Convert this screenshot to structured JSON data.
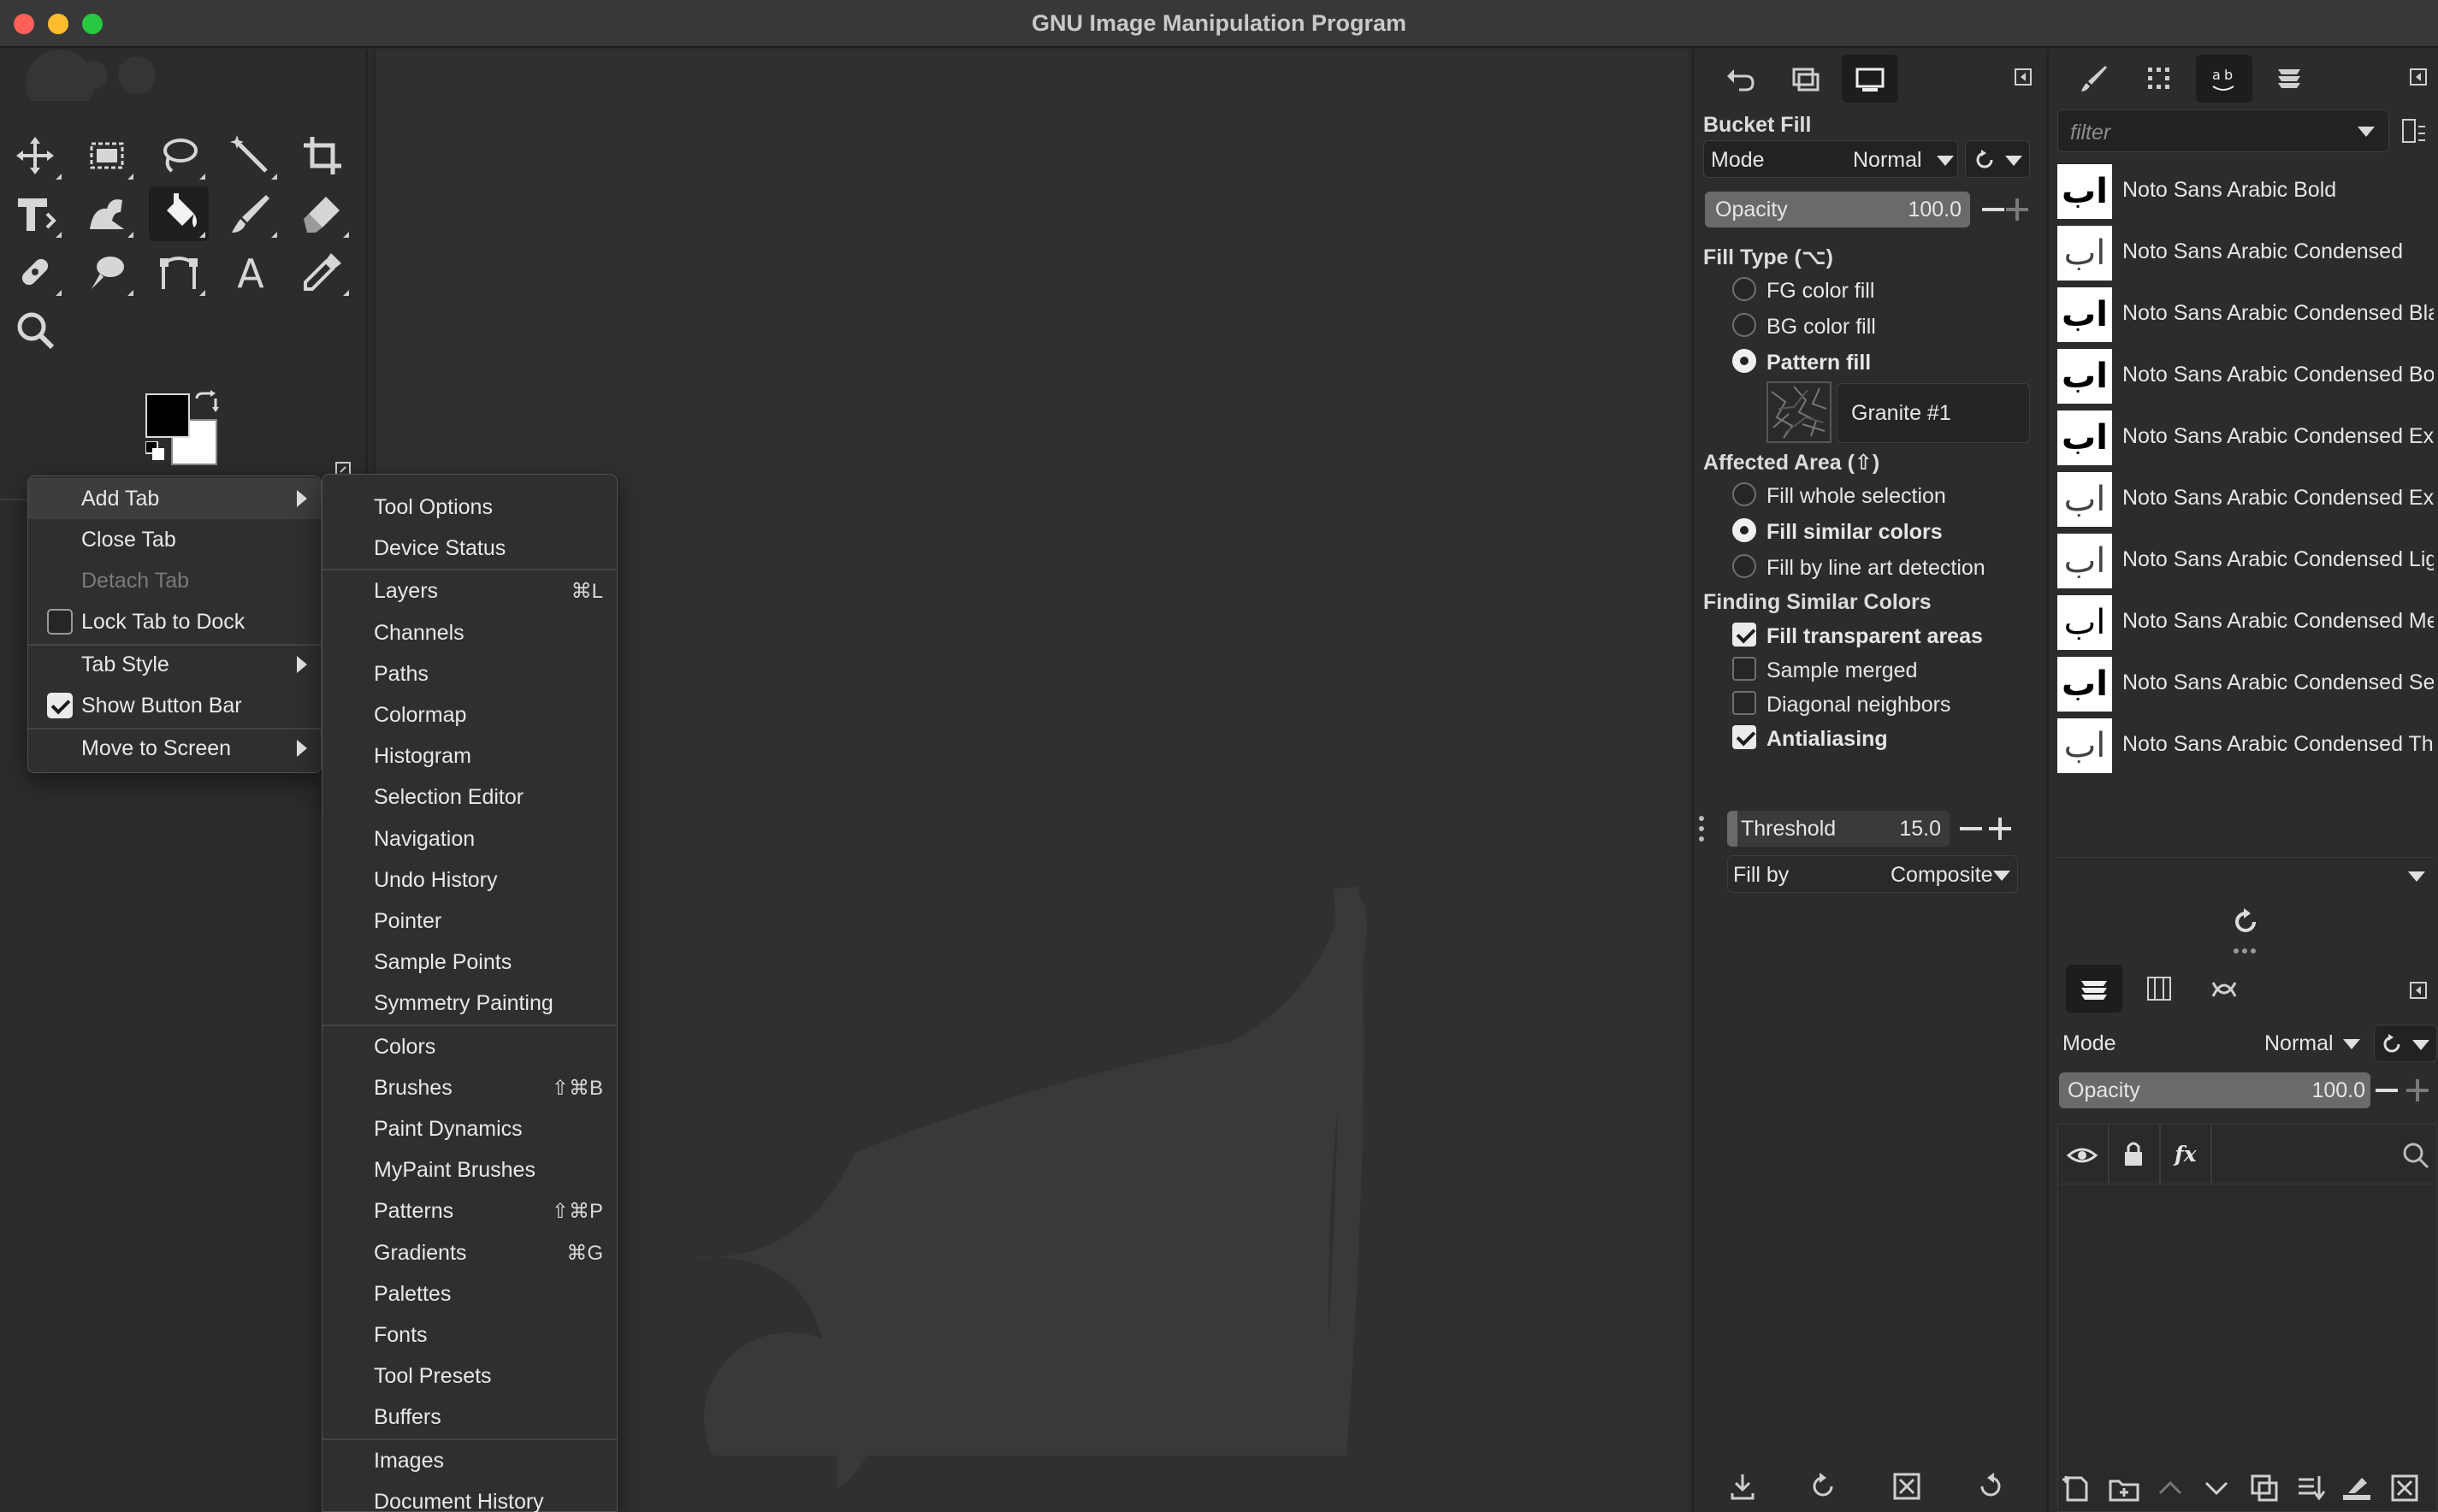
{
  "window": {
    "title": "GNU Image Manipulation Program"
  },
  "context_menu": {
    "items": [
      {
        "label": "Add Tab",
        "submenu": true,
        "highlight": true
      },
      {
        "label": "Close Tab"
      },
      {
        "label": "Detach Tab",
        "disabled": true
      },
      {
        "label": "Lock Tab to Dock",
        "checkbox": true,
        "checked": false
      },
      {
        "label": "Tab Style",
        "submenu": true
      },
      {
        "label": "Show Button Bar",
        "checkbox": true,
        "checked": true
      },
      {
        "label": "Move to Screen",
        "submenu": true
      }
    ]
  },
  "add_tab_menu": {
    "items": [
      {
        "label": "Tool Options",
        "shortcut": ""
      },
      {
        "label": "Device Status",
        "shortcut": ""
      },
      {
        "label": "Layers",
        "shortcut": "⌘L"
      },
      {
        "label": "Channels",
        "shortcut": ""
      },
      {
        "label": "Paths",
        "shortcut": ""
      },
      {
        "label": "Colormap",
        "shortcut": ""
      },
      {
        "label": "Histogram",
        "shortcut": ""
      },
      {
        "label": "Selection Editor",
        "shortcut": ""
      },
      {
        "label": "Navigation",
        "shortcut": ""
      },
      {
        "label": "Undo History",
        "shortcut": ""
      },
      {
        "label": "Pointer",
        "shortcut": ""
      },
      {
        "label": "Sample Points",
        "shortcut": ""
      },
      {
        "label": "Symmetry Painting",
        "shortcut": ""
      },
      {
        "label": "Colors",
        "shortcut": ""
      },
      {
        "label": "Brushes",
        "shortcut": "⇧⌘B"
      },
      {
        "label": "Paint Dynamics",
        "shortcut": ""
      },
      {
        "label": "MyPaint Brushes",
        "shortcut": ""
      },
      {
        "label": "Patterns",
        "shortcut": "⇧⌘P"
      },
      {
        "label": "Gradients",
        "shortcut": "⌘G"
      },
      {
        "label": "Palettes",
        "shortcut": ""
      },
      {
        "label": "Fonts",
        "shortcut": ""
      },
      {
        "label": "Tool Presets",
        "shortcut": ""
      },
      {
        "label": "Buffers",
        "shortcut": ""
      },
      {
        "label": "Images",
        "shortcut": ""
      },
      {
        "label": "Document History",
        "shortcut": ""
      }
    ]
  },
  "tool_options": {
    "title": "Bucket Fill",
    "mode_label": "Mode",
    "mode_value": "Normal",
    "opacity_label": "Opacity",
    "opacity_value": "100.0",
    "fill_type_label": "Fill Type  (⌥)",
    "fill_type_options": [
      {
        "label": "FG color fill",
        "checked": false
      },
      {
        "label": "BG color fill",
        "checked": false
      },
      {
        "label": "Pattern fill",
        "checked": true
      }
    ],
    "pattern_name": "Granite #1",
    "affected_area_label": "Affected Area  (⇧)",
    "affected_area_options": [
      {
        "label": "Fill whole selection",
        "checked": false
      },
      {
        "label": "Fill similar colors",
        "checked": true
      },
      {
        "label": "Fill by line art detection",
        "checked": false
      }
    ],
    "finding_label": "Finding Similar Colors",
    "finding_options": [
      {
        "label": "Fill transparent areas",
        "checked": true
      },
      {
        "label": "Sample merged",
        "checked": false
      },
      {
        "label": "Diagonal neighbors",
        "checked": false
      },
      {
        "label": "Antialiasing",
        "checked": true
      }
    ],
    "threshold_label": "Threshold",
    "threshold_value": "15.0",
    "fill_by_label": "Fill by",
    "fill_by_value": "Composite"
  },
  "fonts_panel": {
    "filter_placeholder": "filter",
    "fonts": [
      {
        "name": "Noto Sans Arabic Bold",
        "style": "bold"
      },
      {
        "name": "Noto Sans Arabic Condensed",
        "style": "light"
      },
      {
        "name": "Noto Sans Arabic Condensed Bla",
        "style": "bold"
      },
      {
        "name": "Noto Sans Arabic Condensed Bo",
        "style": "bold"
      },
      {
        "name": "Noto Sans Arabic Condensed Ex",
        "style": "bold"
      },
      {
        "name": "Noto Sans Arabic Condensed Ex",
        "style": "light"
      },
      {
        "name": "Noto Sans Arabic Condensed Lig",
        "style": "light"
      },
      {
        "name": "Noto Sans Arabic Condensed Me",
        "style": "normal"
      },
      {
        "name": "Noto Sans Arabic Condensed Se",
        "style": "bold"
      },
      {
        "name": "Noto Sans Arabic Condensed Th",
        "style": "light"
      }
    ],
    "font_glyph": "اب"
  },
  "layers_panel": {
    "mode_label": "Mode",
    "mode_value": "Normal",
    "opacity_label": "Opacity",
    "opacity_value": "100.0",
    "fx_label": "fx"
  }
}
